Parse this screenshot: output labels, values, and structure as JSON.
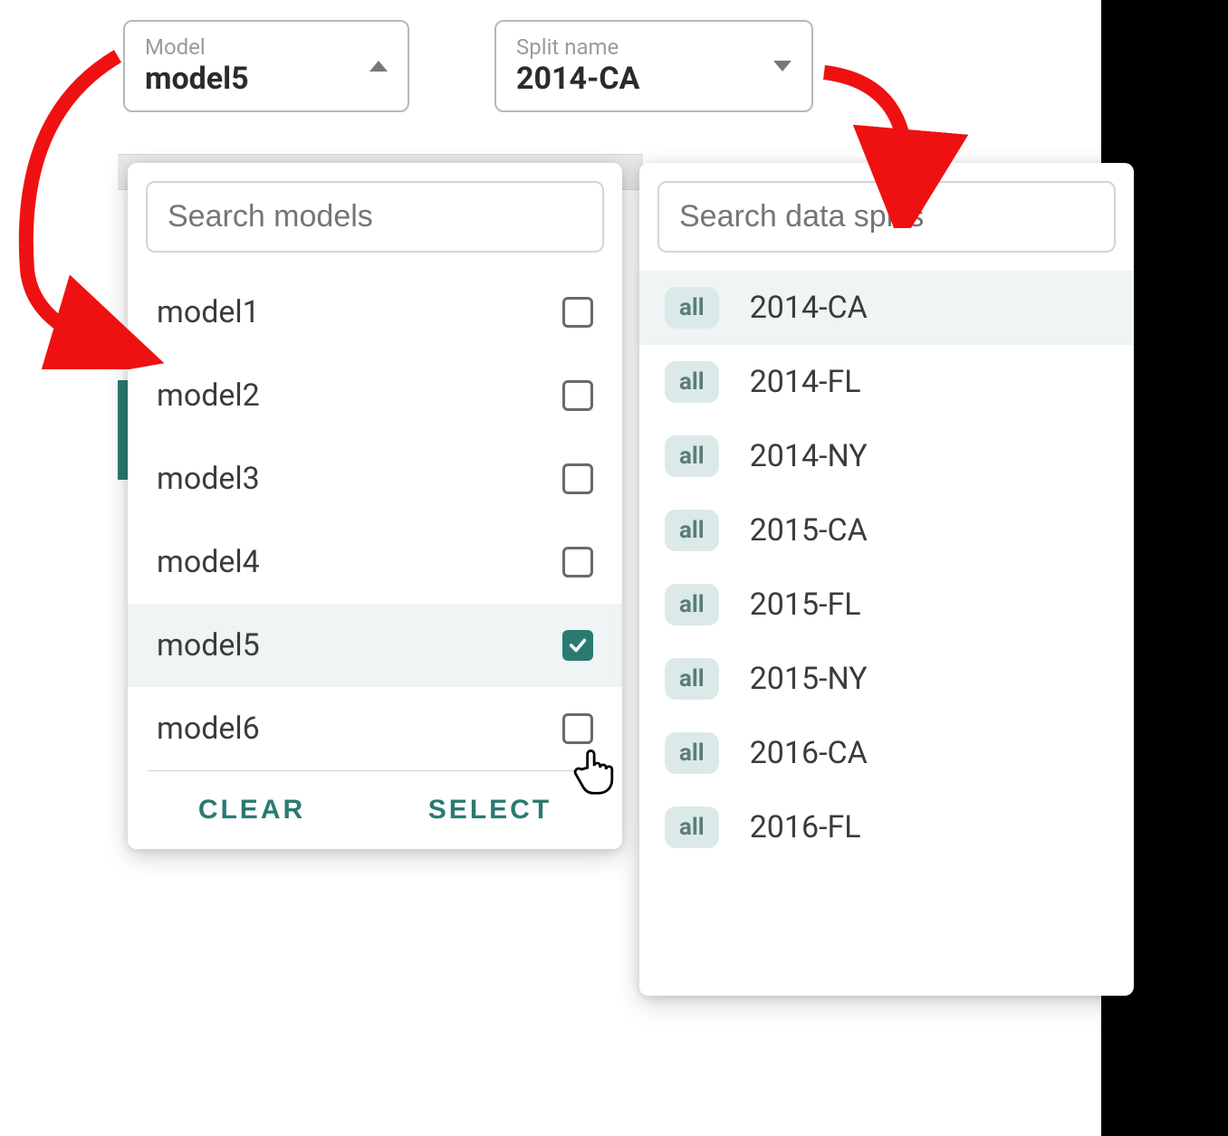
{
  "model_dropdown": {
    "label": "Model",
    "value": "model5"
  },
  "split_dropdown": {
    "label": "Split name",
    "value": "2014-CA"
  },
  "model_panel": {
    "search_placeholder": "Search models",
    "items": [
      {
        "label": "model1",
        "checked": false
      },
      {
        "label": "model2",
        "checked": false
      },
      {
        "label": "model3",
        "checked": false
      },
      {
        "label": "model4",
        "checked": false
      },
      {
        "label": "model5",
        "checked": true
      },
      {
        "label": "model6",
        "checked": false
      }
    ],
    "clear_label": "CLEAR",
    "select_label": "SELECT"
  },
  "split_panel": {
    "search_placeholder": "Search data splits",
    "badge": "all",
    "items": [
      {
        "label": "2014-CA",
        "highlight": true
      },
      {
        "label": "2014-FL",
        "highlight": false
      },
      {
        "label": "2014-NY",
        "highlight": false
      },
      {
        "label": "2015-CA",
        "highlight": false
      },
      {
        "label": "2015-FL",
        "highlight": false
      },
      {
        "label": "2015-NY",
        "highlight": false
      },
      {
        "label": "2016-CA",
        "highlight": false
      },
      {
        "label": "2016-FL",
        "highlight": false
      }
    ]
  },
  "colors": {
    "accent": "#2a7a72",
    "annotation": "#ef1111"
  }
}
